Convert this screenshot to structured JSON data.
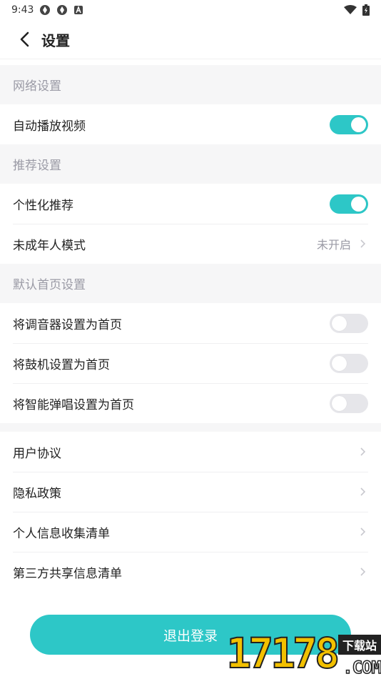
{
  "status_bar": {
    "time": "9:43",
    "icons": [
      "app-icon-1",
      "app-icon-2",
      "a-icon",
      "wifi-icon",
      "battery-icon"
    ]
  },
  "header": {
    "title": "设置",
    "back_icon": "chevron-left-icon"
  },
  "sections": {
    "network": {
      "title": "网络设置",
      "autoplay_label": "自动播放视频",
      "autoplay_on": true
    },
    "recommend": {
      "title": "推荐设置",
      "personalized_label": "个性化推荐",
      "personalized_on": true,
      "minor_mode_label": "未成年人模式",
      "minor_mode_value": "未开启"
    },
    "default_home": {
      "title": "默认首页设置",
      "tuner_label": "将调音器设置为首页",
      "tuner_on": false,
      "drum_label": "将鼓机设置为首页",
      "drum_on": false,
      "smart_play_label": "将智能弹唱设置为首页",
      "smart_play_on": false
    },
    "legal": {
      "items": [
        "用户协议",
        "隐私政策",
        "个人信息收集清单",
        "第三方共享信息清单"
      ]
    }
  },
  "logout": {
    "label": "退出登录"
  },
  "watermark": {
    "number": "17178",
    "badge": "下载站",
    "domain": ".COM"
  },
  "colors": {
    "accent": "#2dc7c7",
    "section_bg": "#f6f6f7",
    "section_text": "#9a9aa5",
    "toggle_off": "#e6e6ea"
  }
}
